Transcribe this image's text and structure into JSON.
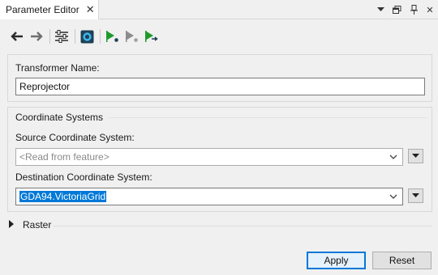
{
  "tab": {
    "title": "Parameter Editor"
  },
  "window_controls": [
    "dropdown-icon",
    "restore-icon",
    "pin-icon",
    "close-icon"
  ],
  "toolbar": [
    "back-arrow-icon",
    "forward-arrow-icon",
    "settings-sliders-icon",
    "transformer-icon",
    "run-icon",
    "run-disabled-icon",
    "run-to-this-icon"
  ],
  "transformer": {
    "name_label": "Transformer Name:",
    "name_value": "Reprojector"
  },
  "coordinate_systems": {
    "group_label": "Coordinate Systems",
    "source_label": "Source Coordinate System:",
    "source_value": "<Read from feature>",
    "destination_label": "Destination Coordinate System:",
    "destination_value": "GDA94.VictoriaGrid"
  },
  "raster": {
    "label": "Raster"
  },
  "buttons": {
    "apply": "Apply",
    "reset": "Reset"
  },
  "colors": {
    "accent": "#0078d7",
    "run_green": "#1e9a2d"
  }
}
